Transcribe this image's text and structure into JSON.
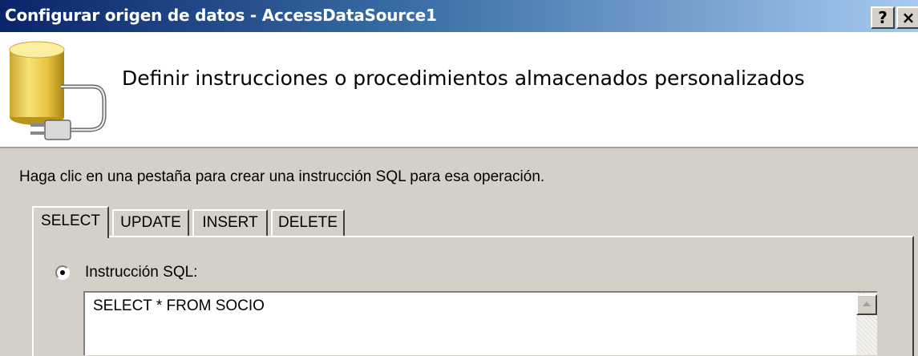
{
  "window": {
    "title": "Configurar origen de datos - AccessDataSource1",
    "help_button": "?",
    "close_button": "×"
  },
  "header": {
    "title": "Definir instrucciones o procedimientos almacenados personalizados",
    "icon": "database-icon"
  },
  "instructions": "Haga clic en una pestaña para crear una instrucción SQL para esa operación.",
  "tabs": [
    {
      "label": "SELECT",
      "active": true
    },
    {
      "label": "UPDATE",
      "active": false
    },
    {
      "label": "INSERT",
      "active": false
    },
    {
      "label": "DELETE",
      "active": false
    }
  ],
  "select_tab": {
    "radio_label": "Instrucción SQL:",
    "radio_checked": true,
    "sql_value": "SELECT * FROM SOCIO"
  }
}
